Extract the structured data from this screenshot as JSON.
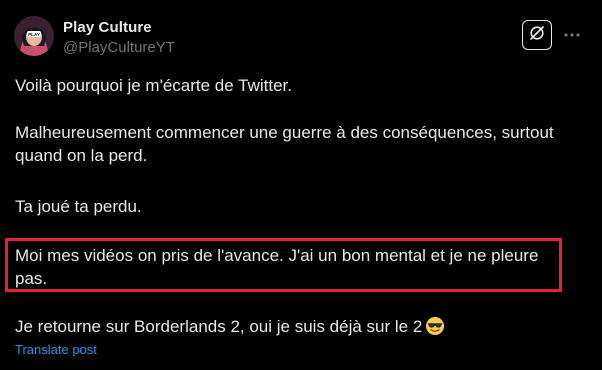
{
  "author": {
    "name": "Play Culture",
    "handle": "@PlayCultureYT",
    "avatar_badge": "PLAY"
  },
  "header_actions": {
    "grok_icon": "grok-icon",
    "more_icon": "more-icon"
  },
  "tweet": {
    "paragraphs": [
      "Voilà pourquoi je m'écarte de Twitter.",
      "Malheureusement commencer une guerre à des conséquences, surtout quand on la perd.",
      "Ta joué ta perdu.",
      "Moi mes vidéos on pris de l'avance. J'ai un bon mental et je ne pleure pas.",
      "Je retourne sur Borderlands 2, oui je suis déjà sur le 2"
    ],
    "emoji": "smiling-face-with-sunglasses",
    "translate_label": "Translate post"
  },
  "colors": {
    "background": "#000000",
    "text": "#e7e9ea",
    "secondary": "#71767b",
    "link": "#1d9bf0",
    "highlight_box": "#e5232a"
  }
}
